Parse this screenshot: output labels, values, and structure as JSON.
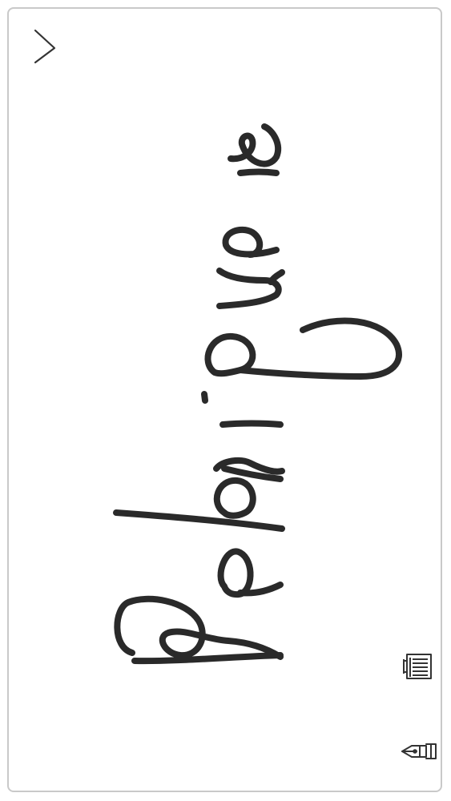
{
  "signature": {
    "text": "Rodriguez",
    "ink_color": "#2a2a2a"
  },
  "toolbar": {
    "back_icon": "chevron-right-icon",
    "clear_icon": "trash-icon",
    "pen_icon": "pen-icon"
  },
  "colors": {
    "border": "#c9c9c9",
    "icon": "#333333",
    "background": "#ffffff"
  }
}
